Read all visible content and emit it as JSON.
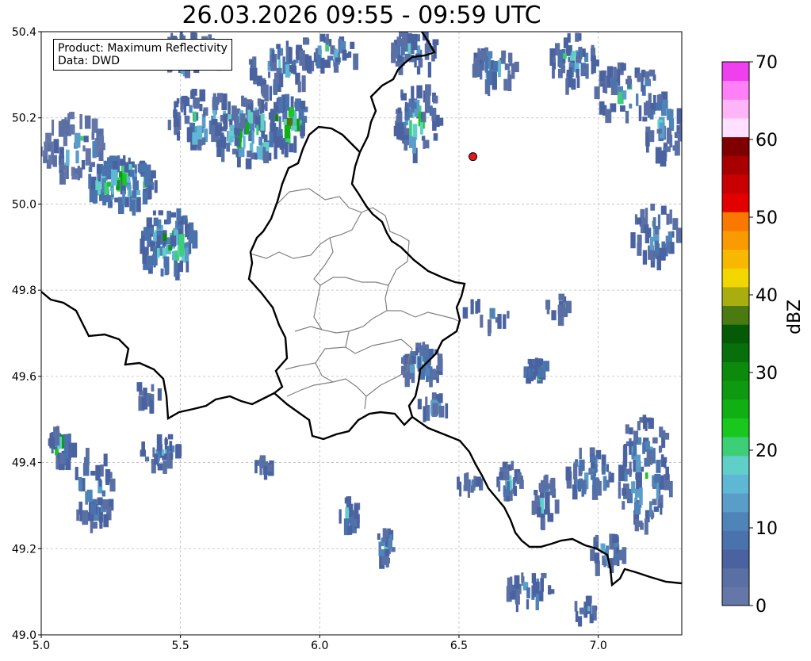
{
  "title": "26.03.2026 09:55 - 09:59 UTC",
  "info": {
    "product": "Product: Maximum Reflectivity",
    "data": "Data: DWD"
  },
  "map": {
    "lon_range": [
      5.0,
      7.3
    ],
    "lat_range": [
      49.0,
      50.4
    ],
    "lon_ticks": [
      "5.0",
      "5.5",
      "6.0",
      "6.5",
      "7.0"
    ],
    "lat_ticks": [
      "50.4",
      "50.2",
      "50.0",
      "49.8",
      "49.6",
      "49.4",
      "49.2",
      "49.0"
    ],
    "grid": true,
    "marker": {
      "lon": 6.55,
      "lat": 50.11,
      "color": "#e31a1c"
    }
  },
  "colorbar": {
    "label": "dBZ",
    "ticks": [
      "70",
      "60",
      "50",
      "40",
      "30",
      "20",
      "10",
      "0"
    ],
    "min": 0,
    "max": 70,
    "step": 2.5,
    "colors": [
      "#6577a8",
      "#5a70a5",
      "#4a63a0",
      "#4a72ac",
      "#4f84b8",
      "#5a9dc9",
      "#5fb7d6",
      "#5fcfc8",
      "#3ccf78",
      "#18c81e",
      "#10b012",
      "#0d9a10",
      "#0b8a0c",
      "#08700a",
      "#055a06",
      "#4a7a10",
      "#a8ae10",
      "#f2d600",
      "#f8b800",
      "#f89a00",
      "#f87800",
      "#e30000",
      "#c80000",
      "#a80000",
      "#7e0000",
      "#ffe0ff",
      "#ffb4f8",
      "#ff80f6",
      "#f040ee"
    ]
  }
}
